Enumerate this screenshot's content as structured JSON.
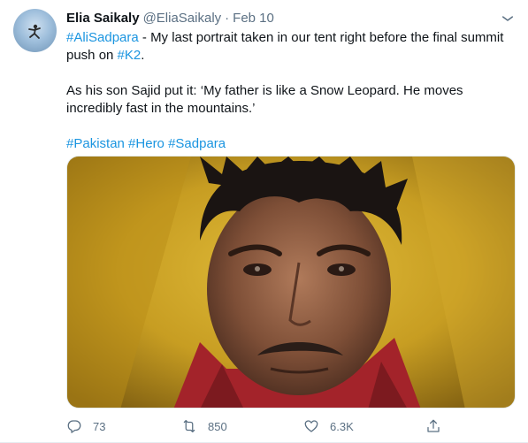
{
  "tweet": {
    "author_name": "Elia Saikaly",
    "handle": "@EliaSaikaly",
    "separator": "·",
    "date": "Feb 10",
    "para1": {
      "tag1": "#AliSadpara",
      "text1": " - My last portrait taken in our tent right before the final summit push on ",
      "tag2": "#K2",
      "text2": "."
    },
    "para2": "As his son Sajid put it: ‘My father is like a Snow Leopard. He moves incredibly fast in the mountains.’",
    "hashtags": [
      "#Pakistan",
      "#Hero",
      "#Sadpara"
    ],
    "link_color": "#1b95e0"
  },
  "actions": {
    "replies": "73",
    "retweets": "850",
    "likes": "6.3K"
  },
  "icons": {
    "more": "more-icon",
    "reply": "reply-icon",
    "retweet": "retweet-icon",
    "like": "heart-icon",
    "share": "share-icon"
  }
}
